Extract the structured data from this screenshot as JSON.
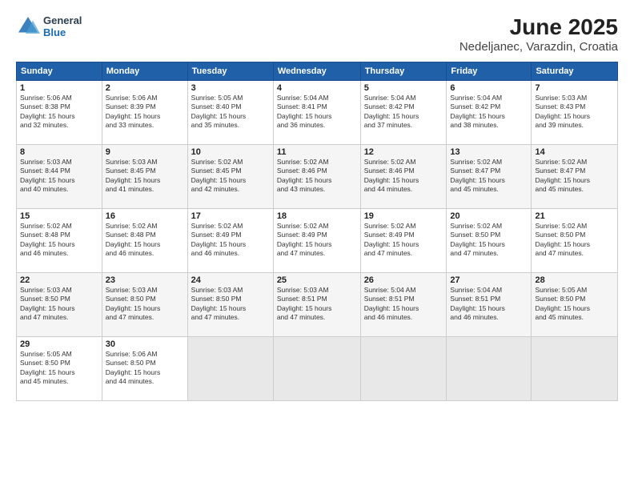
{
  "logo": {
    "general": "General",
    "blue": "Blue"
  },
  "title": "June 2025",
  "subtitle": "Nedeljanec, Varazdin, Croatia",
  "days_header": [
    "Sunday",
    "Monday",
    "Tuesday",
    "Wednesday",
    "Thursday",
    "Friday",
    "Saturday"
  ],
  "weeks": [
    [
      {
        "num": "1",
        "info": "Sunrise: 5:06 AM\nSunset: 8:38 PM\nDaylight: 15 hours\nand 32 minutes."
      },
      {
        "num": "2",
        "info": "Sunrise: 5:06 AM\nSunset: 8:39 PM\nDaylight: 15 hours\nand 33 minutes."
      },
      {
        "num": "3",
        "info": "Sunrise: 5:05 AM\nSunset: 8:40 PM\nDaylight: 15 hours\nand 35 minutes."
      },
      {
        "num": "4",
        "info": "Sunrise: 5:04 AM\nSunset: 8:41 PM\nDaylight: 15 hours\nand 36 minutes."
      },
      {
        "num": "5",
        "info": "Sunrise: 5:04 AM\nSunset: 8:42 PM\nDaylight: 15 hours\nand 37 minutes."
      },
      {
        "num": "6",
        "info": "Sunrise: 5:04 AM\nSunset: 8:42 PM\nDaylight: 15 hours\nand 38 minutes."
      },
      {
        "num": "7",
        "info": "Sunrise: 5:03 AM\nSunset: 8:43 PM\nDaylight: 15 hours\nand 39 minutes."
      }
    ],
    [
      {
        "num": "8",
        "info": "Sunrise: 5:03 AM\nSunset: 8:44 PM\nDaylight: 15 hours\nand 40 minutes."
      },
      {
        "num": "9",
        "info": "Sunrise: 5:03 AM\nSunset: 8:45 PM\nDaylight: 15 hours\nand 41 minutes."
      },
      {
        "num": "10",
        "info": "Sunrise: 5:02 AM\nSunset: 8:45 PM\nDaylight: 15 hours\nand 42 minutes."
      },
      {
        "num": "11",
        "info": "Sunrise: 5:02 AM\nSunset: 8:46 PM\nDaylight: 15 hours\nand 43 minutes."
      },
      {
        "num": "12",
        "info": "Sunrise: 5:02 AM\nSunset: 8:46 PM\nDaylight: 15 hours\nand 44 minutes."
      },
      {
        "num": "13",
        "info": "Sunrise: 5:02 AM\nSunset: 8:47 PM\nDaylight: 15 hours\nand 45 minutes."
      },
      {
        "num": "14",
        "info": "Sunrise: 5:02 AM\nSunset: 8:47 PM\nDaylight: 15 hours\nand 45 minutes."
      }
    ],
    [
      {
        "num": "15",
        "info": "Sunrise: 5:02 AM\nSunset: 8:48 PM\nDaylight: 15 hours\nand 46 minutes."
      },
      {
        "num": "16",
        "info": "Sunrise: 5:02 AM\nSunset: 8:48 PM\nDaylight: 15 hours\nand 46 minutes."
      },
      {
        "num": "17",
        "info": "Sunrise: 5:02 AM\nSunset: 8:49 PM\nDaylight: 15 hours\nand 46 minutes."
      },
      {
        "num": "18",
        "info": "Sunrise: 5:02 AM\nSunset: 8:49 PM\nDaylight: 15 hours\nand 47 minutes."
      },
      {
        "num": "19",
        "info": "Sunrise: 5:02 AM\nSunset: 8:49 PM\nDaylight: 15 hours\nand 47 minutes."
      },
      {
        "num": "20",
        "info": "Sunrise: 5:02 AM\nSunset: 8:50 PM\nDaylight: 15 hours\nand 47 minutes."
      },
      {
        "num": "21",
        "info": "Sunrise: 5:02 AM\nSunset: 8:50 PM\nDaylight: 15 hours\nand 47 minutes."
      }
    ],
    [
      {
        "num": "22",
        "info": "Sunrise: 5:03 AM\nSunset: 8:50 PM\nDaylight: 15 hours\nand 47 minutes."
      },
      {
        "num": "23",
        "info": "Sunrise: 5:03 AM\nSunset: 8:50 PM\nDaylight: 15 hours\nand 47 minutes."
      },
      {
        "num": "24",
        "info": "Sunrise: 5:03 AM\nSunset: 8:50 PM\nDaylight: 15 hours\nand 47 minutes."
      },
      {
        "num": "25",
        "info": "Sunrise: 5:03 AM\nSunset: 8:51 PM\nDaylight: 15 hours\nand 47 minutes."
      },
      {
        "num": "26",
        "info": "Sunrise: 5:04 AM\nSunset: 8:51 PM\nDaylight: 15 hours\nand 46 minutes."
      },
      {
        "num": "27",
        "info": "Sunrise: 5:04 AM\nSunset: 8:51 PM\nDaylight: 15 hours\nand 46 minutes."
      },
      {
        "num": "28",
        "info": "Sunrise: 5:05 AM\nSunset: 8:50 PM\nDaylight: 15 hours\nand 45 minutes."
      }
    ],
    [
      {
        "num": "29",
        "info": "Sunrise: 5:05 AM\nSunset: 8:50 PM\nDaylight: 15 hours\nand 45 minutes."
      },
      {
        "num": "30",
        "info": "Sunrise: 5:06 AM\nSunset: 8:50 PM\nDaylight: 15 hours\nand 44 minutes."
      },
      {
        "num": "",
        "info": ""
      },
      {
        "num": "",
        "info": ""
      },
      {
        "num": "",
        "info": ""
      },
      {
        "num": "",
        "info": ""
      },
      {
        "num": "",
        "info": ""
      }
    ]
  ]
}
